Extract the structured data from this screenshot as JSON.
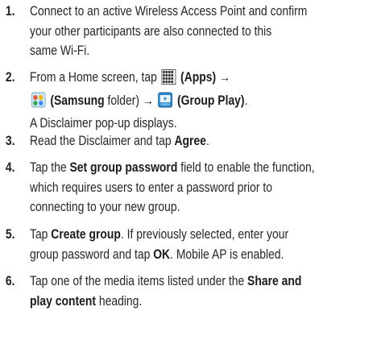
{
  "steps": [
    {
      "number": "1.",
      "lines": [
        "Connect to an active Wireless Access Point and confirm",
        "your other participants are also connected to this",
        "same Wi-Fi."
      ]
    },
    {
      "number": "2.",
      "line1": {
        "a": "From a Home screen, tap ",
        "b": "(Apps)",
        "c": " →"
      },
      "line2": {
        "a": "(Samsung",
        "b": " folder) → ",
        "c": "(Group Play)",
        "d": "."
      },
      "line3": "A Disclaimer pop-up displays.",
      "icons": [
        "apps-grid-icon",
        "samsung-folder-icon",
        "group-play-icon"
      ]
    },
    {
      "number": "3.",
      "parts": {
        "a": "Read the Disclaimer and tap ",
        "b": "Agree",
        "c": "."
      }
    },
    {
      "number": "4.",
      "line1": {
        "a": "Tap the ",
        "b": "Set group password",
        "c": " field to enable the function,"
      },
      "line2": "which requires users to enter a password prior to",
      "line3": "connecting to your new group."
    },
    {
      "number": "5.",
      "line1": {
        "a": "Tap ",
        "b": "Create group",
        "c": ". If previously selected, enter your"
      },
      "line2": {
        "a": "group password and tap ",
        "b": "OK",
        "c": ". Mobile AP is enabled."
      }
    },
    {
      "number": "6.",
      "line1": {
        "a": "Tap one of the media items listed under the ",
        "b": "Share and"
      },
      "line2": {
        "a": "play content",
        "b": " heading."
      }
    }
  ]
}
